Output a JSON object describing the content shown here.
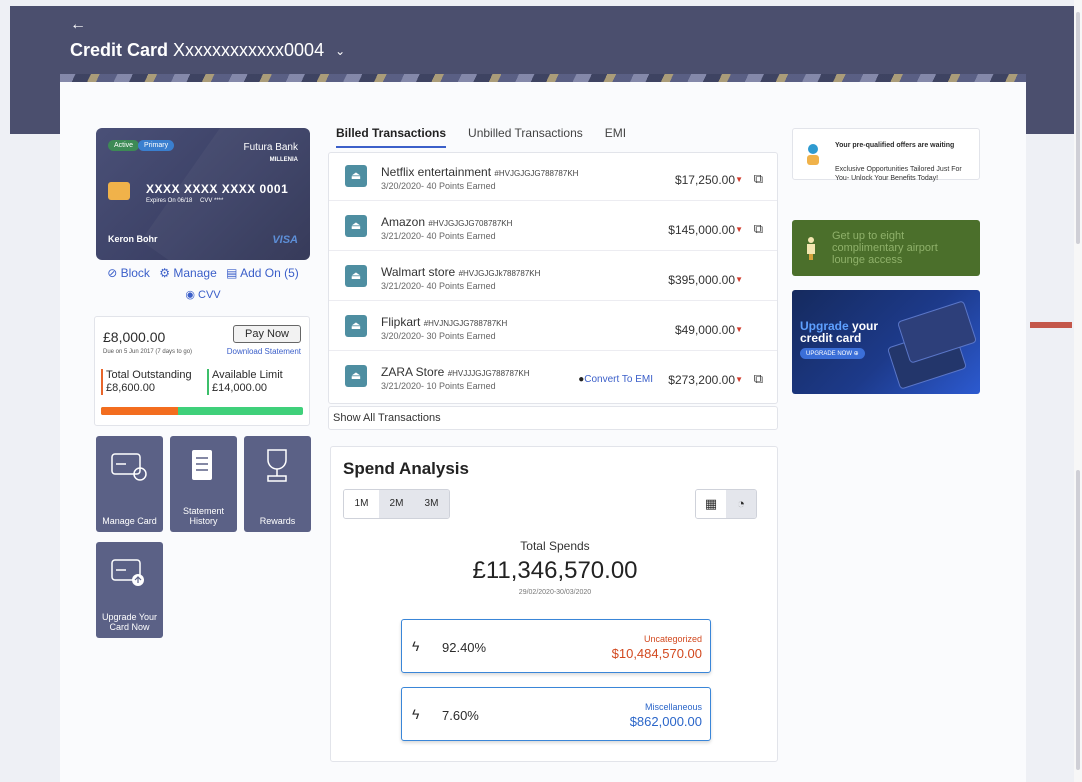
{
  "header": {
    "back_label": "←",
    "title_bold": "Credit Card",
    "title_number": "Xxxxxxxxxxxx0004",
    "chevron": "⌄"
  },
  "card": {
    "status": "Active",
    "type": "Primary",
    "bank": "Futura Bank",
    "variant": "MILLENIA",
    "number": "XXXX XXXX XXXX 0001",
    "expiry": "Expires On 06/18",
    "cvv_masked": "CVV ****",
    "holder": "Keron Bohr",
    "network": "VISA"
  },
  "card_actions": {
    "block": "⊘ Block",
    "manage": "⚙ Manage",
    "addon": "▤ Add On (5)",
    "cvv": "◉ CVV"
  },
  "dues": {
    "amount": "£8,000.00",
    "due_note": "Due on 5 Jun 2017 (7 days to go)",
    "pay_now": "Pay Now",
    "download": "Download Statement",
    "total_label": "Total Outstanding",
    "total_value": "£8,600.00",
    "available_label": "Available Limit",
    "available_value": "£14,000.00",
    "used_fraction": 0.38
  },
  "tiles": [
    {
      "label": "Manage Card"
    },
    {
      "label": "Statement History"
    },
    {
      "label": "Rewards"
    },
    {
      "label": "Upgrade Your Card Now"
    }
  ],
  "tabs": [
    "Billed Transactions",
    "Unbilled Transactions",
    "EMI"
  ],
  "transactions": [
    {
      "name": "Netflix entertainment",
      "ref": "#HVJGJGJG788787KH",
      "meta": "3/20/2020- 40 Points Earned",
      "amount": "$17,250.00",
      "emi": ""
    },
    {
      "name": "Amazon",
      "ref": "#HVJGJGJG708787KH",
      "meta": "3/21/2020- 40 Points Earned",
      "amount": "$145,000.00",
      "emi": ""
    },
    {
      "name": "Walmart store",
      "ref": "#HVJGJGJk788787KH",
      "meta": "3/21/2020- 40 Points Earned",
      "amount": "$395,000.00",
      "emi": ""
    },
    {
      "name": "Flipkart",
      "ref": "#HVJNJGJG788787KH",
      "meta": "3/20/2020- 30 Points Earned",
      "amount": "$49,000.00",
      "emi": ""
    },
    {
      "name": "ZARA Store",
      "ref": "#HVJJJGJG788787KH",
      "meta": "3/21/2020- 10 Points Earned",
      "amount": "$273,200.00",
      "emi": "Convert To EMI"
    }
  ],
  "show_all": "Show All Transactions",
  "spend": {
    "title": "Spend Analysis",
    "periods": [
      "1M",
      "2M",
      "3M"
    ],
    "total_label": "Total Spends",
    "total_value": "£11,346,570.00",
    "date_range": "29/02/2020-30/03/2020",
    "categories": [
      {
        "pct": "92.40%",
        "name": "Uncategorized",
        "value": "$10,484,570.00",
        "color": "#d2491f"
      },
      {
        "pct": "7.60%",
        "name": "Miscellaneous",
        "value": "$862,000.00",
        "color": "#2b66c9"
      }
    ]
  },
  "offers": {
    "title": "Your pre-qualified offers are waiting",
    "desc": "Exclusive Opportunities Tailored Just For You- Unlock Your Benefits Today!",
    "lounge": "Get up to eight complimentary airport lounge access",
    "promo_hl": "Upgrade",
    "promo_rest": " your",
    "promo_line2": "credit card",
    "promo_btn": "UPGRADE NOW ⊕"
  }
}
